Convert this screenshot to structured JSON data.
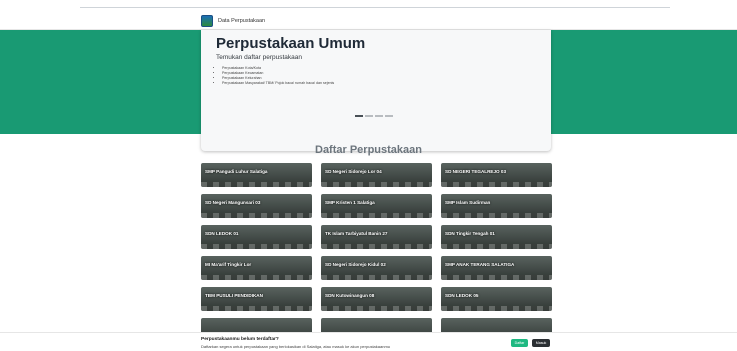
{
  "navbar": {
    "brand": "Data Perpustakaan",
    "logo_icon": "seal-icon"
  },
  "hero": {
    "title": "Perpustakaan Umum",
    "subtitle": "Temukan daftar perpustakaan",
    "items": [
      "Perpustakaan Kota/Kota",
      "Perpustakaan Kecamatan",
      "Perpustakaan Kelurahan",
      "Perpustakaan Masyarakat/ TBM/ Pojok baca/ rumah baca/ dan sejenis"
    ],
    "slides": 4,
    "active_slide": 0
  },
  "list": {
    "title": "Daftar Perpustakaan",
    "items": [
      "SMP Pangudi Luhur Salatiga",
      "SD Negeri Sidorejo Lor 04",
      "SD NEGERI TEGALREJO 03",
      "SD Negeri Mangunsari 03",
      "SMP Kristen 1 Salatiga",
      "SMP Islam Sudirman",
      "SDN LEDOK 01",
      "TK Islam Tarbiyatul Banin 27",
      "SDN Tingkir Tengah 01",
      "MI Ma'arif Tingkir Lor",
      "SD Negeri Sidorejo Kidul 02",
      "SMP ANAK TERANG SALATIGA",
      "TBM PUSULI PENDIDIKAN",
      "SDN Kutowinangun 08",
      "SDN LEDOK 05"
    ]
  },
  "footer": {
    "question": "Perpustakaanmu belum terdaftar?",
    "description": "Daftarkan segera untuk perpustakaan yang berlokasikan di Salatiga, atau masuk ke akun perpustakaanmu",
    "register_label": "Daftar",
    "login_label": "Masuk"
  },
  "colors": {
    "hero_bg": "#199a73",
    "register": "#1fb982",
    "login": "#2b2f33"
  }
}
